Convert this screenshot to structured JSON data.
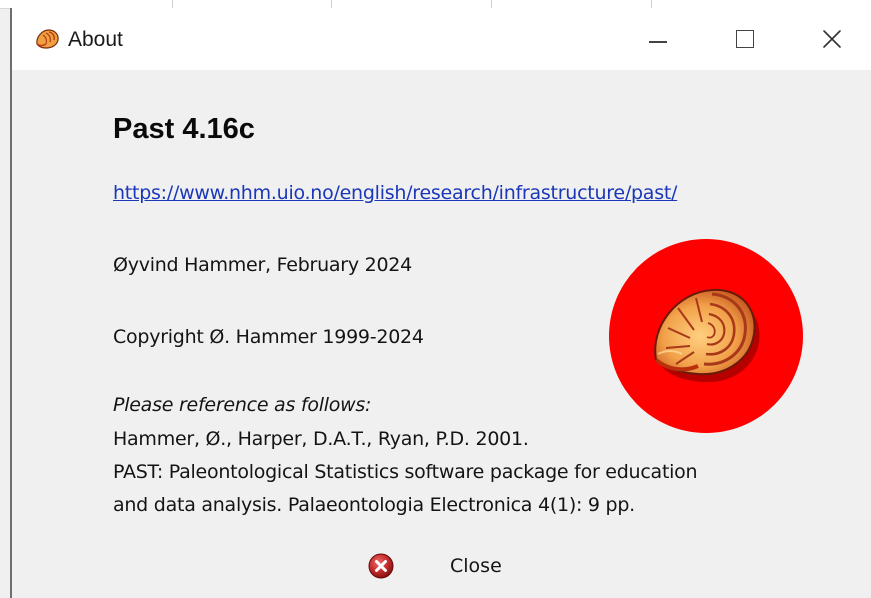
{
  "window": {
    "title": "About",
    "title_icon": "nautilus-shell-icon",
    "controls": {
      "minimize": "minimize-icon",
      "maximize": "maximize-icon",
      "close": "close-x-icon"
    }
  },
  "about": {
    "app_name": "Past 4.16c",
    "website": "https://www.nhm.uio.no/english/research/infrastructure/past/",
    "author_line": "Øyvind Hammer, February 2024",
    "copyright_line": "Copyright Ø. Hammer 1999-2024",
    "reference_heading": "Please reference as follows:",
    "reference_lines": [
      "Hammer, Ø., Harper, D.A.T., Ryan, P.D. 2001.",
      "PAST: Paleontological Statistics software package for education",
      "and data analysis. Palaeontologia Electronica 4(1): 9 pp."
    ],
    "logo": "nautilus-shell-logo"
  },
  "buttons": {
    "close_label": "Close",
    "close_icon": "red-x-circle-icon"
  },
  "colors": {
    "link": "#1a37b8",
    "logo_red": "#ff0000",
    "background": "#f0f0f0"
  }
}
